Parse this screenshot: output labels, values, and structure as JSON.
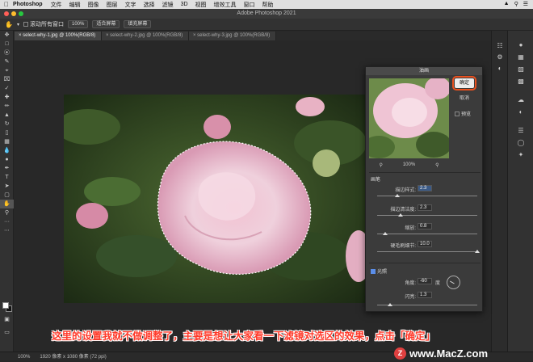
{
  "menubar": {
    "app": "Photoshop",
    "items": [
      "文件",
      "编辑",
      "图像",
      "图层",
      "文字",
      "选择",
      "滤镜",
      "3D",
      "视图",
      "增效工具",
      "窗口",
      "帮助"
    ]
  },
  "window": {
    "title": "Adobe Photoshop 2021"
  },
  "options_bar": {
    "scroll_all_label": "滚动所有窗口",
    "zoom": "100%",
    "fit_screen": "适合屏幕",
    "fill_screen": "填充屏幕"
  },
  "tabs": [
    {
      "label": "select-why-1.jpg @ 100%(RGB/8)",
      "active": true
    },
    {
      "label": "select-why-2.jpg @ 100%(RGB/8)",
      "active": false
    },
    {
      "label": "select-why-3.jpg @ 100%(RGB/8)",
      "active": false
    }
  ],
  "dialog": {
    "title": "油画",
    "ok": "确定",
    "cancel": "取消",
    "preview": "预览",
    "zoom": "100%",
    "brush_section": "画笔",
    "stylization_label": "描边样式:",
    "stylization_value": "2.3",
    "cleanliness_label": "描边清洁度:",
    "cleanliness_value": "2.3",
    "scale_label": "缩放:",
    "scale_value": "0.8",
    "bristle_label": "硬毛刷细节:",
    "bristle_value": "10.0",
    "lighting_section": "光照",
    "angle_label": "角度:",
    "angle_value": "-60",
    "angle_unit": "度",
    "shine_label": "闪亮:",
    "shine_value": "1.3",
    "sliders": {
      "stylization": 0.2,
      "cleanliness": 0.23,
      "scale": 0.08,
      "bristle": 1.0,
      "shine": 0.13
    }
  },
  "status": {
    "zoom": "100%",
    "doc_info": "1920 像素 x 1080 像素 (72 ppi)"
  },
  "caption": "这里的设置我就不做调整了，主要是想让大家看一下滤镜对选区的效果，点击「确定」",
  "watermark": {
    "logo": "Z",
    "text": "www.MacZ.com"
  },
  "colors": {
    "ok_highlight": "#e8501f",
    "caption": "#ff3a2a"
  }
}
